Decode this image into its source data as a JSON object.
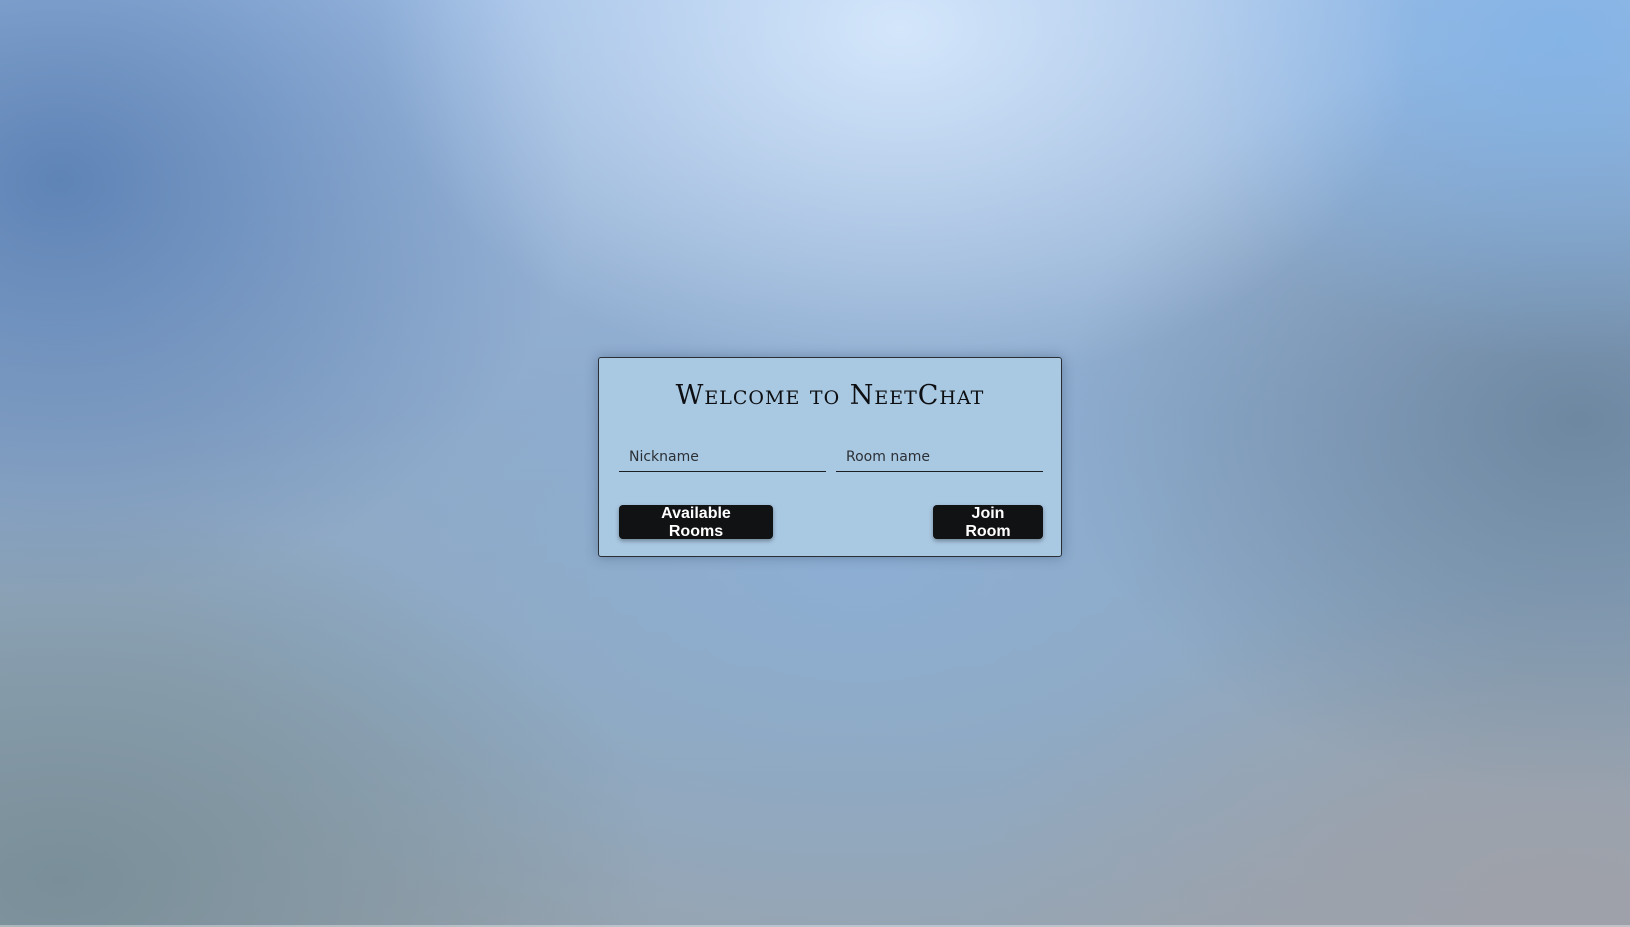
{
  "app": {
    "title": "Welcome to NeetChat"
  },
  "form": {
    "nickname": {
      "placeholder": "Nickname",
      "value": ""
    },
    "room": {
      "placeholder": "Room name",
      "value": ""
    }
  },
  "actions": {
    "available_rooms_label": "Available Rooms",
    "join_room_label": "Join Room"
  },
  "colors": {
    "card_background": "#a9c8e2",
    "button_background": "#111214",
    "button_text": "#ffffff"
  }
}
